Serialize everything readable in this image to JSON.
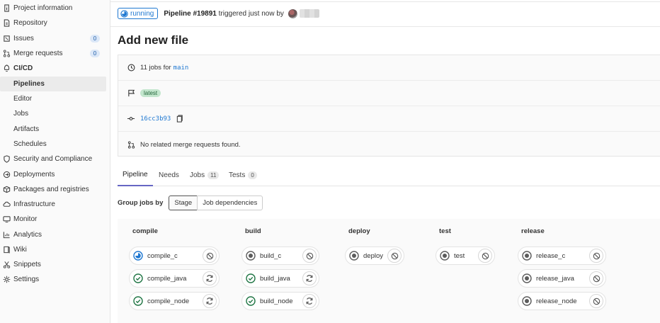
{
  "sidebar": {
    "items": [
      {
        "label": "Project information",
        "icon": "info-icon"
      },
      {
        "label": "Repository",
        "icon": "doc-icon"
      },
      {
        "label": "Issues",
        "icon": "issues-icon",
        "badge": "0"
      },
      {
        "label": "Merge requests",
        "icon": "merge-icon",
        "badge": "0"
      },
      {
        "label": "CI/CD",
        "icon": "rocket-icon"
      },
      {
        "label": "Pipelines"
      },
      {
        "label": "Editor"
      },
      {
        "label": "Jobs"
      },
      {
        "label": "Artifacts"
      },
      {
        "label": "Schedules"
      },
      {
        "label": "Security and Compliance",
        "icon": "shield-icon"
      },
      {
        "label": "Deployments",
        "icon": "deploy-icon"
      },
      {
        "label": "Packages and registries",
        "icon": "package-icon"
      },
      {
        "label": "Infrastructure",
        "icon": "cloud-icon"
      },
      {
        "label": "Monitor",
        "icon": "monitor-icon"
      },
      {
        "label": "Analytics",
        "icon": "chart-icon"
      },
      {
        "label": "Wiki",
        "icon": "book-icon"
      },
      {
        "label": "Snippets",
        "icon": "scissors-icon"
      },
      {
        "label": "Settings",
        "icon": "gear-icon"
      }
    ]
  },
  "header": {
    "status": "running",
    "pipeline_id": "Pipeline #19891",
    "triggered_text": "triggered just now by"
  },
  "page_title": "Add new file",
  "info": {
    "jobs_prefix": "11 jobs for",
    "branch": "main",
    "latest_badge": "latest",
    "commit_sha": "16cc3b93",
    "mr_text": "No related merge requests found."
  },
  "tabs": [
    {
      "label": "Pipeline"
    },
    {
      "label": "Needs"
    },
    {
      "label": "Jobs",
      "count": "11"
    },
    {
      "label": "Tests",
      "count": "0"
    }
  ],
  "group_by": {
    "label": "Group jobs by",
    "options": [
      "Stage",
      "Job dependencies"
    ],
    "selected": "Stage"
  },
  "stages": [
    {
      "name": "compile",
      "jobs": [
        {
          "name": "compile_c",
          "status": "running",
          "action": "cancel"
        },
        {
          "name": "compile_java",
          "status": "success",
          "action": "retry"
        },
        {
          "name": "compile_node",
          "status": "success",
          "action": "retry"
        }
      ]
    },
    {
      "name": "build",
      "jobs": [
        {
          "name": "build_c",
          "status": "created",
          "action": "cancel"
        },
        {
          "name": "build_java",
          "status": "success",
          "action": "retry"
        },
        {
          "name": "build_node",
          "status": "success",
          "action": "retry"
        }
      ]
    },
    {
      "name": "deploy",
      "jobs": [
        {
          "name": "deploy",
          "status": "created",
          "action": "cancel"
        }
      ]
    },
    {
      "name": "test",
      "jobs": [
        {
          "name": "test",
          "status": "created",
          "action": "cancel"
        }
      ]
    },
    {
      "name": "release",
      "jobs": [
        {
          "name": "release_c",
          "status": "created",
          "action": "cancel"
        },
        {
          "name": "release_java",
          "status": "created",
          "action": "cancel"
        },
        {
          "name": "release_node",
          "status": "created",
          "action": "cancel"
        }
      ]
    }
  ],
  "colors": {
    "running": "#1f78d1",
    "success": "#217645",
    "created": "#5c5c5c",
    "tab_active": "#6666c4"
  }
}
